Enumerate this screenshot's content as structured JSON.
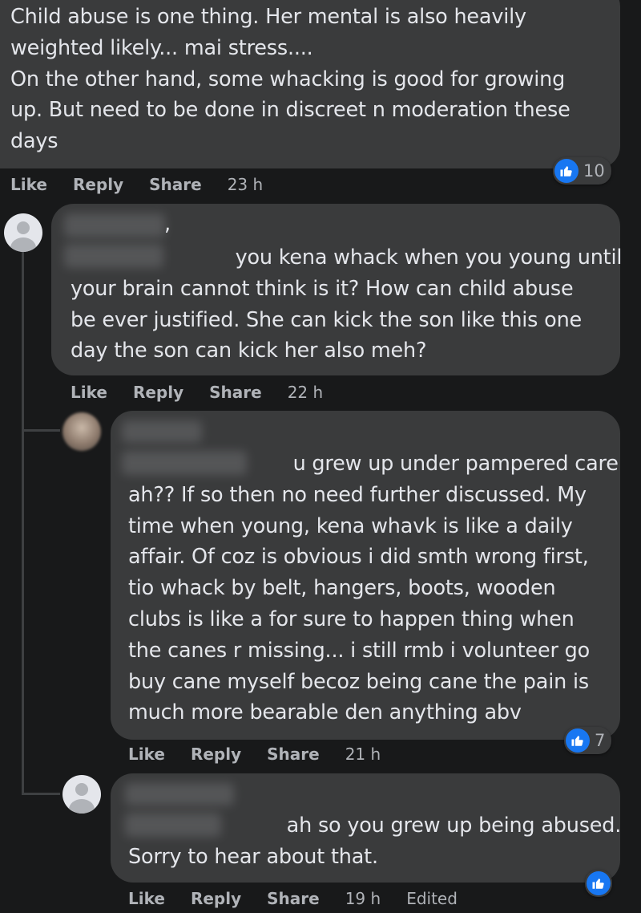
{
  "comments": [
    {
      "text": "Child abuse is one thing. Her mental is also heavily\nweighted likely... mai stress....\nOn the other hand, some whacking is good for growing\nup. But need to be done in discreet n moderation these\ndays",
      "actions": {
        "like": "Like",
        "reply": "Reply",
        "share": "Share",
        "time": "23 h"
      },
      "reaction_count": "10"
    },
    {
      "name_fragment": ",",
      "text": "                          you kena whack when you young until\nyour brain cannot think is it? How can child abuse\nbe ever justified. She can kick the son like this one\nday the son can kick her also meh?",
      "actions": {
        "like": "Like",
        "reply": "Reply",
        "share": "Share",
        "time": "22 h"
      }
    },
    {
      "text": "                          u grew up under pampered care\nah?? If so then no need further discussed. My\ntime when young, kena whavk is like a daily\naffair. Of coz is obvious i did smth wrong first,\ntio whack by belt, hangers, boots, wooden\nclubs is like a for sure to happen thing when\nthe canes r missing... i still rmb i volunteer go\nbuy cane myself becoz being cane the pain is\nmuch more bearable den anything abv",
      "actions": {
        "like": "Like",
        "reply": "Reply",
        "share": "Share",
        "time": "21 h"
      },
      "reaction_count": "7"
    },
    {
      "text": "                         ah so you grew up being abused.\nSorry to hear about that.",
      "actions": {
        "like": "Like",
        "reply": "Reply",
        "share": "Share",
        "time": "19 h",
        "edited": "Edited"
      }
    }
  ],
  "colors": {
    "background": "#18191a",
    "bubble": "#3a3b3c",
    "text": "#e4e6eb",
    "secondary_text": "#b0b3b8",
    "like_blue": "#1877f2"
  },
  "icons": {
    "like": "thumbs-up-icon",
    "default_avatar": "default-avatar-icon"
  }
}
